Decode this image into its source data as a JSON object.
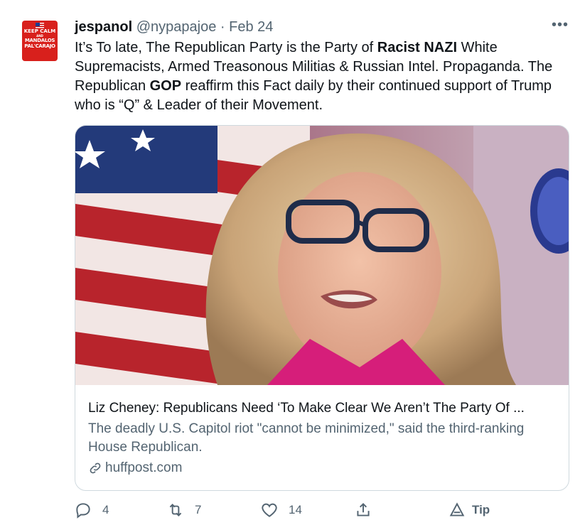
{
  "tweet": {
    "display_name": "jespanol",
    "handle": "@nypapajoe",
    "separator": "·",
    "date": "Feb 24",
    "text_parts": [
      {
        "text": "It’s To late, The Republican Party is the Party of ",
        "bold": false
      },
      {
        "text": "Racist NAZI",
        "bold": true
      },
      {
        "text": " White Supremacists, Armed Treasonous Militias & Russian Intel. Propaganda. The Republican ",
        "bold": false
      },
      {
        "text": "GOP",
        "bold": true
      },
      {
        "text": " reaffirm this Fact daily by their continued support of Trump who is “Q” & Leader of their Movement.",
        "bold": false
      }
    ],
    "avatar": {
      "line1": "KEEP CALM",
      "line2": "AND",
      "line3": "MANDALOS PAL'CARAJO"
    }
  },
  "card": {
    "title": "Liz Cheney: Republicans Need ‘To Make Clear We Aren’t The Party Of ...",
    "description": "The deadly U.S. Capitol riot \"cannot be minimized,\" said the third-ranking House Republican.",
    "domain": "huffpost.com"
  },
  "actions": {
    "reply_count": "4",
    "retweet_count": "7",
    "like_count": "14",
    "tip_label": "Tip"
  },
  "icons": [
    "more-icon",
    "reply-icon",
    "retweet-icon",
    "like-icon",
    "share-icon",
    "tip-icon",
    "link-icon"
  ],
  "colors": {
    "text": "#0f1419",
    "muted": "#536471",
    "border": "#cfd9de",
    "avatar": "#d8201c"
  }
}
